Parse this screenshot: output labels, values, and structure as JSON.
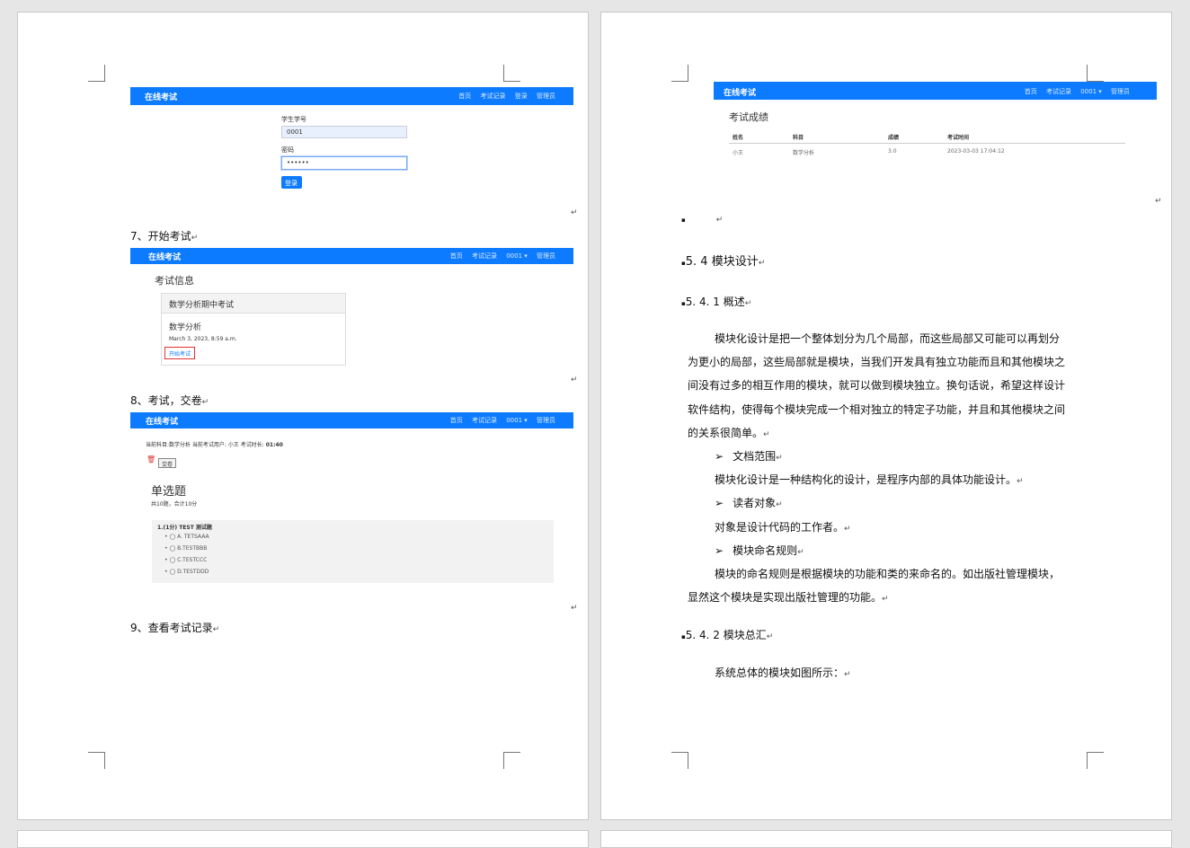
{
  "left_page": {
    "login_shot": {
      "brand": "在线考试",
      "nav_links": [
        "首页",
        "考试记录",
        "登录",
        "管理员"
      ],
      "student_id_label": "学生学号",
      "student_id_value": "0001",
      "password_label": "密码",
      "password_value": "••••••",
      "login_button": "登录"
    },
    "step7": "7、开始考试",
    "exam_info_shot": {
      "brand": "在线考试",
      "nav_links": [
        "首页",
        "考试记录",
        "0001 ▾",
        "管理员"
      ],
      "title": "考试信息",
      "card_header": "数学分析期中考试",
      "subject": "数学分析",
      "date": "March 3, 2023, 8:59 a.m.",
      "start_button": "开始考试"
    },
    "step8": "8、考试，交卷",
    "exam_shot": {
      "brand": "在线考试",
      "nav_links": [
        "首页",
        "考试记录",
        "0001 ▾",
        "管理员"
      ],
      "status_line": "当前科目:数学分析 当前考试用户: 小王 考试时长:",
      "timer": "01:40",
      "submit_button": "交卷",
      "section_title": "单选题",
      "section_sub": "共10题，合计10分",
      "question": "1.(1分) TEST 测试题",
      "options": [
        "A. TETSAAA",
        "B.TESTBBB",
        "C.TESTCCC",
        "D.TESTDDD"
      ]
    },
    "step9": "9、查看考试记录"
  },
  "right_page": {
    "score_shot": {
      "brand": "在线考试",
      "nav_links": [
        "首页",
        "考试记录",
        "0001 ▾",
        "管理员"
      ],
      "title": "考试成绩",
      "headers": [
        "姓名",
        "科目",
        "成绩",
        "考试时间"
      ],
      "row": [
        "小王",
        "数学分析",
        "3.0",
        "2023-03-03 17:04:12"
      ]
    },
    "section_5_4": "5. 4 模块设计",
    "section_5_4_1": "5. 4. 1 概述",
    "para1_lines": [
      "模块化设计是把一个整体划分为几个局部，而这些局部又可能可以再划分",
      "为更小的局部，这些局部就是模块，当我们开发具有独立功能而且和其他模块之",
      "间没有过多的相互作用的模块，就可以做到模块独立。换句话说，希望这样设计",
      "软件结构，使得每个模块完成一个相对独立的特定子功能，并且和其他模块之间",
      "的关系很简单。"
    ],
    "bullet1": "文档范围",
    "bullet1_text": "模块化设计是一种结构化的设计，是程序内部的具体功能设计。",
    "bullet2": "读者对象",
    "bullet2_text": "对象是设计代码的工作者。",
    "bullet3": "模块命名规则",
    "bullet3_lines": [
      "模块的命名规则是根据模块的功能和类的来命名的。如出版社管理模块，",
      "显然这个模块是实现出版社管理的功能。"
    ],
    "section_5_4_2": "5. 4. 2 模块总汇",
    "para_last": "系统总体的模块如图所示：",
    "return_mark": "↵",
    "arrow_glyph": "➢",
    "dot_glyph": "▪"
  }
}
